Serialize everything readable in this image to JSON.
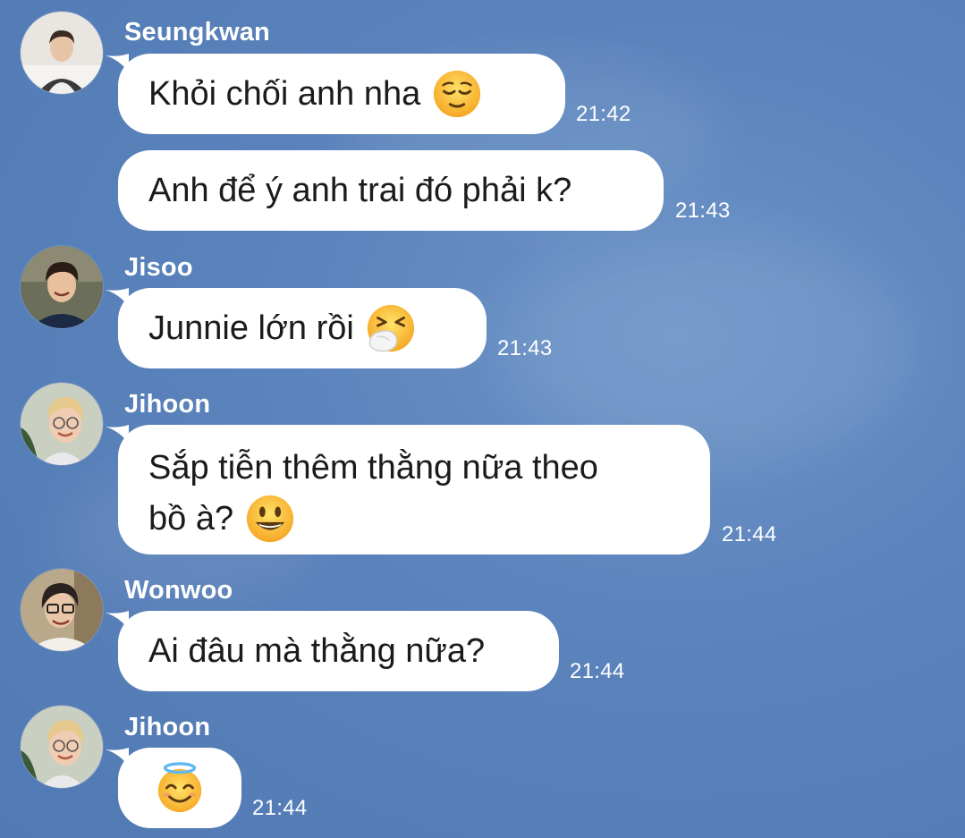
{
  "messages": [
    {
      "sender": "Seungkwan",
      "text": "Khỏi chối anh nha",
      "emoji": "relieved-face-icon",
      "time": "21:42"
    },
    {
      "sender": "",
      "text": "Anh để ý anh trai đó phải k?",
      "emoji": "",
      "time": "21:43"
    },
    {
      "sender": "Jisoo",
      "text": "Junnie lớn rồi",
      "emoji": "sneezing-face-icon",
      "time": "21:43"
    },
    {
      "sender": "Jihoon",
      "text_line1": "Sắp tiễn thêm thằng nữa theo",
      "text_line2": "bồ à?",
      "emoji": "grinning-face-icon",
      "time": "21:44"
    },
    {
      "sender": "Wonwoo",
      "text": "Ai đâu mà thằng nữa?",
      "emoji": "",
      "time": "21:44"
    },
    {
      "sender": "Jihoon",
      "text": "",
      "emoji": "smiling-face-with-halo-icon",
      "time": "21:44"
    }
  ],
  "colors": {
    "background": "#5a82bb",
    "bubble": "#ffffff",
    "text": "#1b1b1b",
    "meta_text": "#ffffff"
  }
}
